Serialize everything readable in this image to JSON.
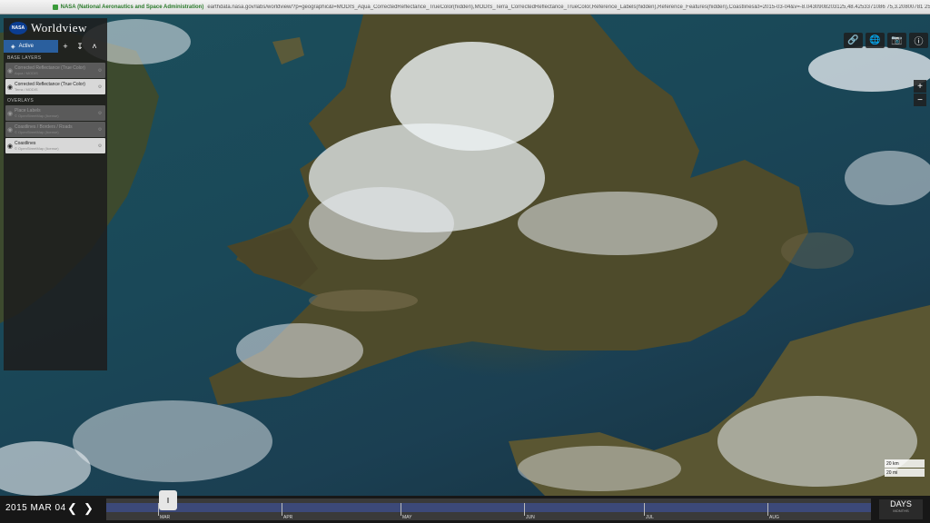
{
  "browser": {
    "owner": "NASA (National Aeronautics and Space Administration)",
    "url": "earthdata.nasa.gov/labs/worldview/?p=geographic&l=MODIS_Aqua_CorrectedReflectance_TrueColor(hidden),MODIS_Terra_CorrectedReflectance_TrueColor,Reference_Labels(hidden),Reference_Features(hidden),Coastlines&t=2015-03-04&v=-8.0430908203125,48.4253371086 75,3.20800781 25,54.3778686 59375"
  },
  "app": {
    "logo": "NASA",
    "name": "Worldview"
  },
  "panel": {
    "tab_active": "Active",
    "base_layers_heading": "BASE LAYERS",
    "overlays_heading": "OVERLAYS",
    "base_layers": [
      {
        "title": "Corrected Reflectance (True Color)",
        "subtitle": "Aqua / MODIS",
        "visible": false
      },
      {
        "title": "Corrected Reflectance (True Color)",
        "subtitle": "Terra / MODIS",
        "visible": true
      }
    ],
    "overlays": [
      {
        "title": "Place Labels",
        "subtitle": "© OpenStreetMap (license)",
        "visible": false
      },
      {
        "title": "Coastlines / Borders / Roads",
        "subtitle": "© OpenStreetMap (license)",
        "visible": false
      },
      {
        "title": "Coastlines",
        "subtitle": "© OpenStreetMap (license)",
        "visible": true
      }
    ]
  },
  "map": {
    "scale_km": "20 km",
    "scale_mi": "20 mi"
  },
  "timeline": {
    "date": "2015 MAR 04",
    "months": [
      "MAR",
      "APR",
      "MAY",
      "JUN",
      "JUL",
      "AUG"
    ],
    "unit": "DAYS",
    "unit_sub": "MONTHS"
  }
}
